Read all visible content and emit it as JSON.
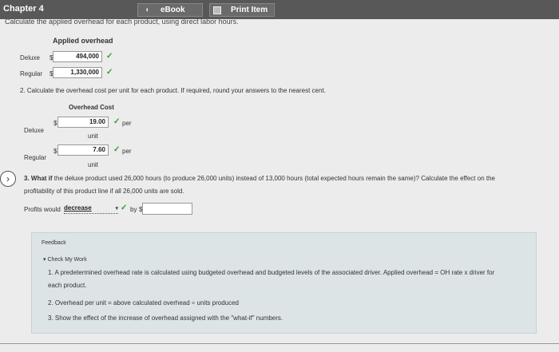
{
  "header": {
    "chapter": "Chapter 4",
    "ebook_label": "eBook",
    "print_label": "Print Item",
    "cut_off_text": "Calculate the applied overhead for each product, using direct labor hours."
  },
  "applied_overhead": {
    "heading": "Applied overhead",
    "rows": [
      {
        "label": "Deluxe",
        "currency": "$",
        "value": "494,000"
      },
      {
        "label": "Regular",
        "currency": "$",
        "value": "1,330,000"
      }
    ]
  },
  "question2": {
    "prompt": "2. Calculate the overhead cost per unit for each product. If required, round your answers to the nearest cent.",
    "column_heading": "Overhead Cost",
    "rows": [
      {
        "label": "Deluxe",
        "currency": "$",
        "value": "19.00",
        "per": "per",
        "unit": "unit"
      },
      {
        "label": "Regular",
        "currency": "$",
        "value": "7.60",
        "per": "per",
        "unit": "unit"
      }
    ]
  },
  "question3": {
    "prompt_bold": "3. What if",
    "prompt_line1": " the deluxe product used 26,000 hours (to produce 26,000 units) instead of 13,000 hours (total expected hours remain the same)? Calculate the effect on the",
    "prompt_line2": "profitability of this product line if all 26,000 units are sold.",
    "profits_label": "Profits would",
    "select_value": "decrease",
    "by_label": "by",
    "currency": "$",
    "amount_value": ""
  },
  "feedback": {
    "title": "Feedback",
    "check_label": "Check My Work",
    "item1_line1": "1. A predetermined overhead rate is calculated using budgeted overhead and budgeted levels of the associated driver. Applied overhead = OH rate x driver for",
    "item1_line2": "each product.",
    "item2": "2. Overhead per unit = above calculated overhead ÷ units produced",
    "item3": "3. Show the effect of the increase of overhead assigned with the \"what-if\" numbers."
  },
  "colors": {
    "topbar": "#585858",
    "check": "#2e9b3a",
    "feedback_bg": "#dce4e6"
  }
}
